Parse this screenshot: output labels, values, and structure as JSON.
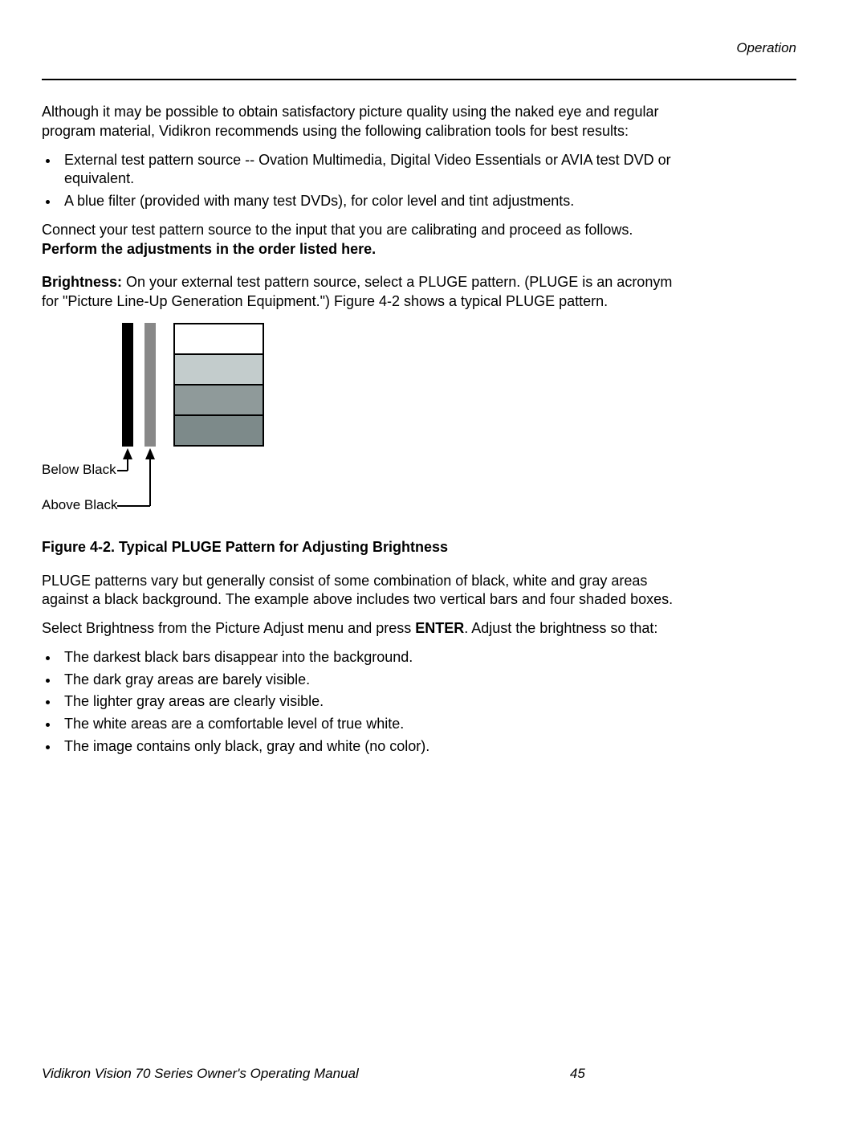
{
  "header": {
    "section_label": "Operation"
  },
  "intro": {
    "para": "Although it may be possible to obtain satisfactory picture quality using the naked eye and regular program material, Vidikron recommends using the following calibration tools for best results:",
    "bullets": [
      "External test pattern source -- Ovation Multimedia, Digital Video Essentials or AVIA test DVD or equivalent.",
      "A blue filter (provided with many test DVDs), for color level and tint adjustments."
    ],
    "connect_line": "Connect your test pattern source to the input that you are calibrating and proceed as follows.",
    "perform_line": "Perform the adjustments in the order listed here."
  },
  "brightness": {
    "label": "Brightness:",
    "text": " On your external test pattern source, select a PLUGE pattern. (PLUGE is an acronym for \"Picture Line-Up Generation Equipment.\") Figure 4-2 shows a typical PLUGE pattern."
  },
  "figure": {
    "below_label": "Below Black",
    "above_label": "Above Black",
    "caption": "Figure 4-2. Typical PLUGE Pattern for Adjusting Brightness"
  },
  "after_fig": {
    "para1": "PLUGE patterns vary but generally consist of some combination of black, white and gray areas against a black background. The example above includes two vertical bars and four shaded boxes.",
    "para2_pre": "Select Brightness from the Picture Adjust menu and press ",
    "para2_bold": "ENTER",
    "para2_post": ". Adjust the brightness so that:",
    "bullets": [
      "The darkest black bars disappear into the background.",
      "The dark gray areas are barely visible.",
      "The lighter gray areas are clearly visible.",
      "The white areas are a comfortable level of true white.",
      "The image contains only black, gray and white (no color)."
    ]
  },
  "footer": {
    "title": "Vidikron Vision 70 Series Owner's Operating Manual",
    "page": "45"
  }
}
